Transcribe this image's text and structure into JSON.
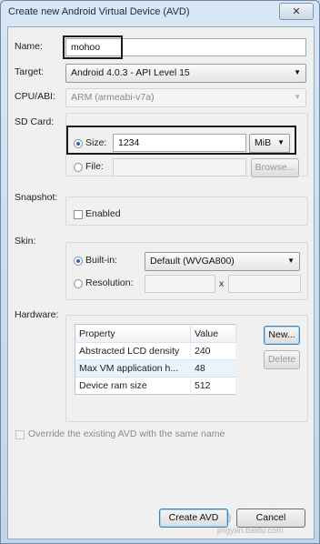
{
  "window": {
    "title": "Create new Android Virtual Device (AVD)",
    "close_label": "✕"
  },
  "name": {
    "label": "Name:",
    "value": "mohoo"
  },
  "target": {
    "label": "Target:",
    "value": "Android 4.0.3 - API Level 15"
  },
  "cpu_abi": {
    "label": "CPU/ABI:",
    "value": "ARM (armeabi-v7a)"
  },
  "sd_card": {
    "label": "SD Card:",
    "size_label": "Size:",
    "size_value": "1234",
    "unit": "MiB",
    "file_label": "File:",
    "file_value": "",
    "browse_label": "Browse..."
  },
  "snapshot": {
    "label": "Snapshot:",
    "enabled_label": "Enabled",
    "enabled": false
  },
  "skin": {
    "label": "Skin:",
    "builtin_label": "Built-in:",
    "builtin_value": "Default (WVGA800)",
    "resolution_label": "Resolution:",
    "res_x": "",
    "res_sep": "x",
    "res_y": ""
  },
  "hardware": {
    "label": "Hardware:",
    "columns": [
      "Property",
      "Value"
    ],
    "rows": [
      {
        "property": "Abstracted LCD density",
        "value": "240"
      },
      {
        "property": "Max VM application h...",
        "value": "48"
      },
      {
        "property": "Device ram size",
        "value": "512"
      }
    ],
    "new_label": "New...",
    "delete_label": "Delete"
  },
  "override": {
    "label": "Override the existing AVD with the same name",
    "checked": false
  },
  "actions": {
    "create_label": "Create AVD",
    "cancel_label": "Cancel"
  },
  "watermark": {
    "text": "Bai⊕ 经验",
    "sub": "jingyan.baidu.com"
  }
}
